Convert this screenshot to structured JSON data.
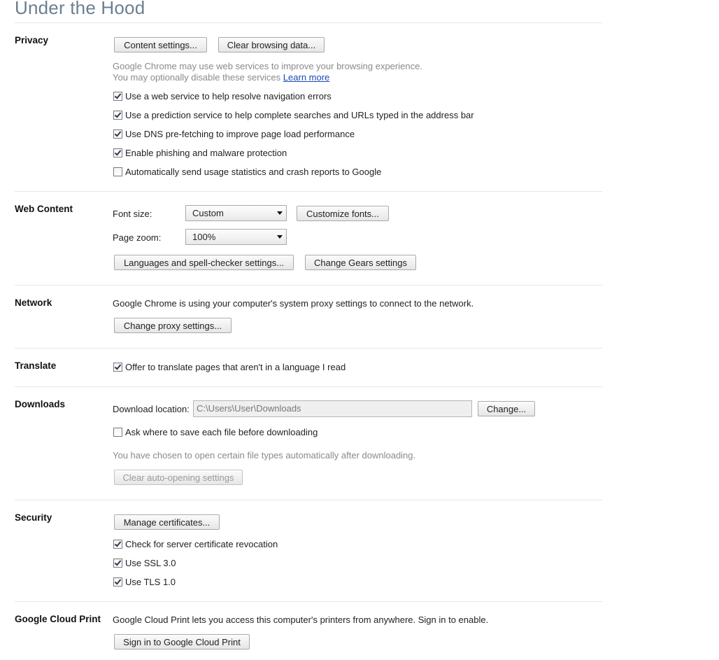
{
  "page": {
    "title": "Under the Hood"
  },
  "privacy": {
    "label": "Privacy",
    "content_settings": "Content settings...",
    "clear_browsing": "Clear browsing data...",
    "description_line1": "Google Chrome may use web services to improve your browsing experience.",
    "description_line2": "You may optionally disable these services",
    "learn_more": "Learn more",
    "options": [
      {
        "label": "Use a web service to help resolve navigation errors",
        "checked": true
      },
      {
        "label": "Use a prediction service to help complete searches and URLs typed in the address bar",
        "checked": true
      },
      {
        "label": "Use DNS pre-fetching to improve page load performance",
        "checked": true
      },
      {
        "label": "Enable phishing and malware protection",
        "checked": true
      },
      {
        "label": "Automatically send usage statistics and crash reports to Google",
        "checked": false
      }
    ]
  },
  "web_content": {
    "label": "Web Content",
    "font_size_label": "Font size:",
    "font_size_value": "Custom",
    "customize_fonts": "Customize fonts...",
    "page_zoom_label": "Page zoom:",
    "page_zoom_value": "100%",
    "languages": "Languages and spell-checker settings...",
    "gears": "Change Gears settings"
  },
  "network": {
    "label": "Network",
    "description": "Google Chrome is using your computer's system proxy settings to connect to the network.",
    "change_proxy": "Change proxy settings..."
  },
  "translate": {
    "label": "Translate",
    "option": {
      "label": "Offer to translate pages that aren't in a language I read",
      "checked": true
    }
  },
  "downloads": {
    "label": "Downloads",
    "location_label": "Download location:",
    "location_value": "C:\\Users\\User\\Downloads",
    "change": "Change...",
    "ask_option": {
      "label": "Ask where to save each file before downloading",
      "checked": false
    },
    "auto_open_note": "You have chosen to open certain file types automatically after downloading.",
    "clear_auto_open": "Clear auto-opening settings"
  },
  "security": {
    "label": "Security",
    "manage_certs": "Manage certificates...",
    "options": [
      {
        "label": "Check for server certificate revocation",
        "checked": true
      },
      {
        "label": "Use SSL 3.0",
        "checked": true
      },
      {
        "label": "Use TLS 1.0",
        "checked": true
      }
    ]
  },
  "cloud_print": {
    "label": "Google Cloud Print",
    "description": "Google Cloud Print lets you access this computer's printers from anywhere. Sign in to enable.",
    "sign_in": "Sign in to Google Cloud Print"
  }
}
